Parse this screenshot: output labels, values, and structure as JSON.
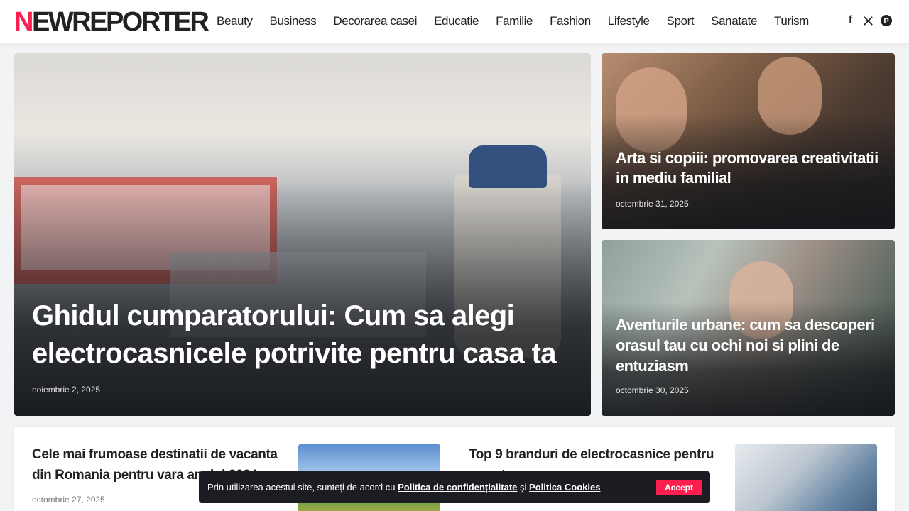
{
  "logo": {
    "first_letter": "N",
    "rest": "EWREPORTER"
  },
  "nav": [
    "Beauty",
    "Business",
    "Decorarea casei",
    "Educatie",
    "Familie",
    "Fashion",
    "Lifestyle",
    "Sport",
    "Sanatate",
    "Turism"
  ],
  "social": {
    "facebook": "f",
    "x": "𝕏",
    "pinterest": "P"
  },
  "featured": {
    "title": "Ghidul cumparatorului: Cum sa alegi electrocasnicele potrivite pentru casa ta",
    "date": "noiembrie 2, 2025"
  },
  "side": [
    {
      "title": "Arta si copiii: promovarea creativitatii in mediu familial",
      "date": "octombrie 31, 2025"
    },
    {
      "title": "Aventurile urbane: cum sa descoperi orasul tau cu ochi noi si plini de entuziasm",
      "date": "octombrie 30, 2025"
    }
  ],
  "list": [
    {
      "title": "Cele mai frumoase destinatii de vacanta din Romania pentru vara anului 2024",
      "date": "octombrie 27, 2025"
    },
    {
      "title": "Top 9 branduri de electrocasnice pentru casa ta"
    }
  ],
  "cookie": {
    "text_before": "Prin utilizarea acestui site, sunteți de acord cu ",
    "privacy_link": "Politica de confidențialitate",
    "and": " și ",
    "cookies_link": "Politica Cookies",
    "accept": "Accept"
  },
  "colors": {
    "accent": "#ff1f4f",
    "dark": "#1b1d22"
  }
}
